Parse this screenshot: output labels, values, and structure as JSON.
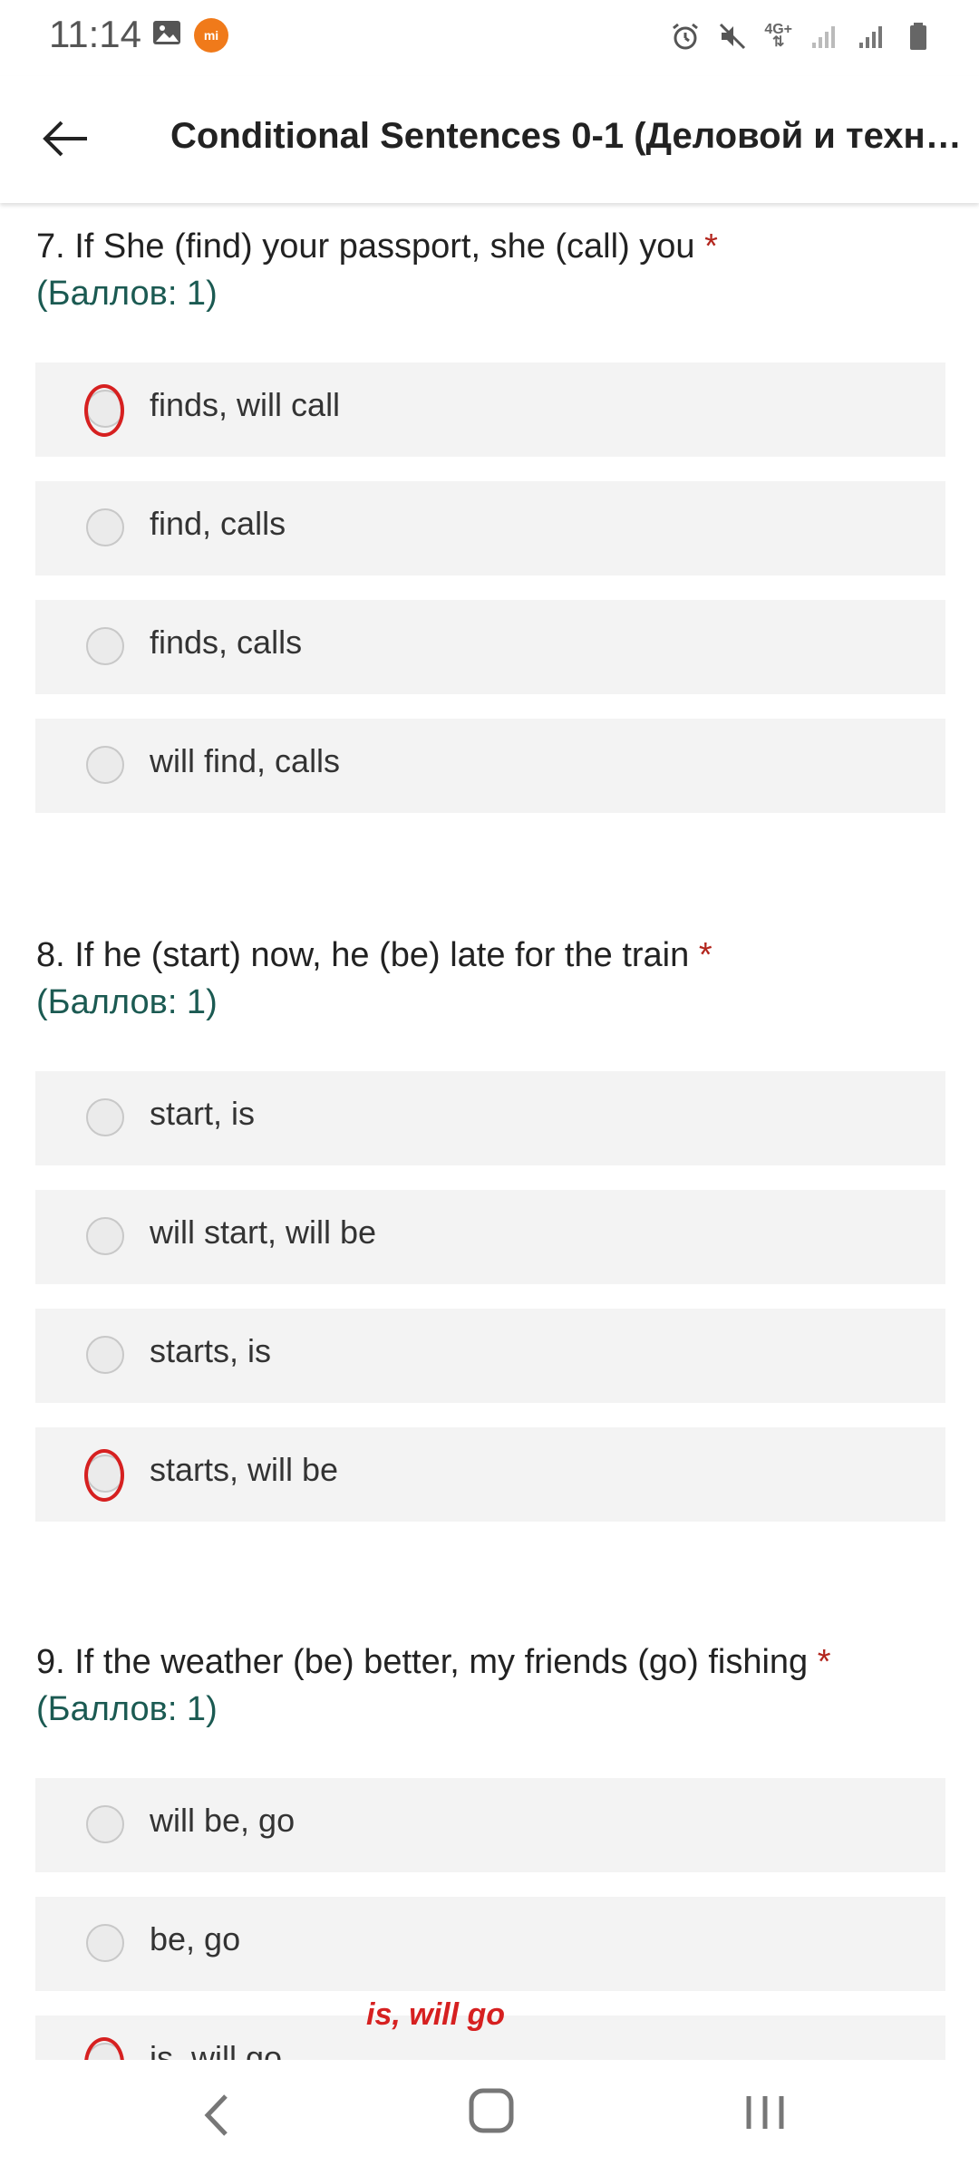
{
  "status_bar": {
    "time": "11:14",
    "network": "4G+"
  },
  "app_bar": {
    "title": "Conditional Sentences 0-1 (Деловой и техни…"
  },
  "questions": [
    {
      "title": "7. If She (find) your passport, she (call) you",
      "required_mark": "*",
      "points": "(Баллов: 1)",
      "options": [
        {
          "label": "finds, will call",
          "circled": true
        },
        {
          "label": "find, calls",
          "circled": false
        },
        {
          "label": "finds, calls",
          "circled": false
        },
        {
          "label": "will find, calls",
          "circled": false
        }
      ]
    },
    {
      "title": "8. If he (start) now, he (be) late for the train",
      "required_mark": "*",
      "points": "(Баллов: 1)",
      "options": [
        {
          "label": "start, is",
          "circled": false
        },
        {
          "label": "will start, will be",
          "circled": false
        },
        {
          "label": "starts, is",
          "circled": false
        },
        {
          "label": "starts, will be",
          "circled": true
        }
      ]
    },
    {
      "title": "9. If the weather (be) better, my friends (go) fishing",
      "required_mark": "*",
      "points": "(Баллов: 1)",
      "options": [
        {
          "label": "will be, go",
          "circled": false
        },
        {
          "label": "be, go",
          "circled": false
        },
        {
          "label": "is, will go",
          "circled": true
        }
      ]
    }
  ],
  "annotation": "is, will go",
  "colors": {
    "required": "#b3261e",
    "points": "#1b5a52",
    "mark": "#d62020",
    "option_bg": "#f3f3f3"
  }
}
